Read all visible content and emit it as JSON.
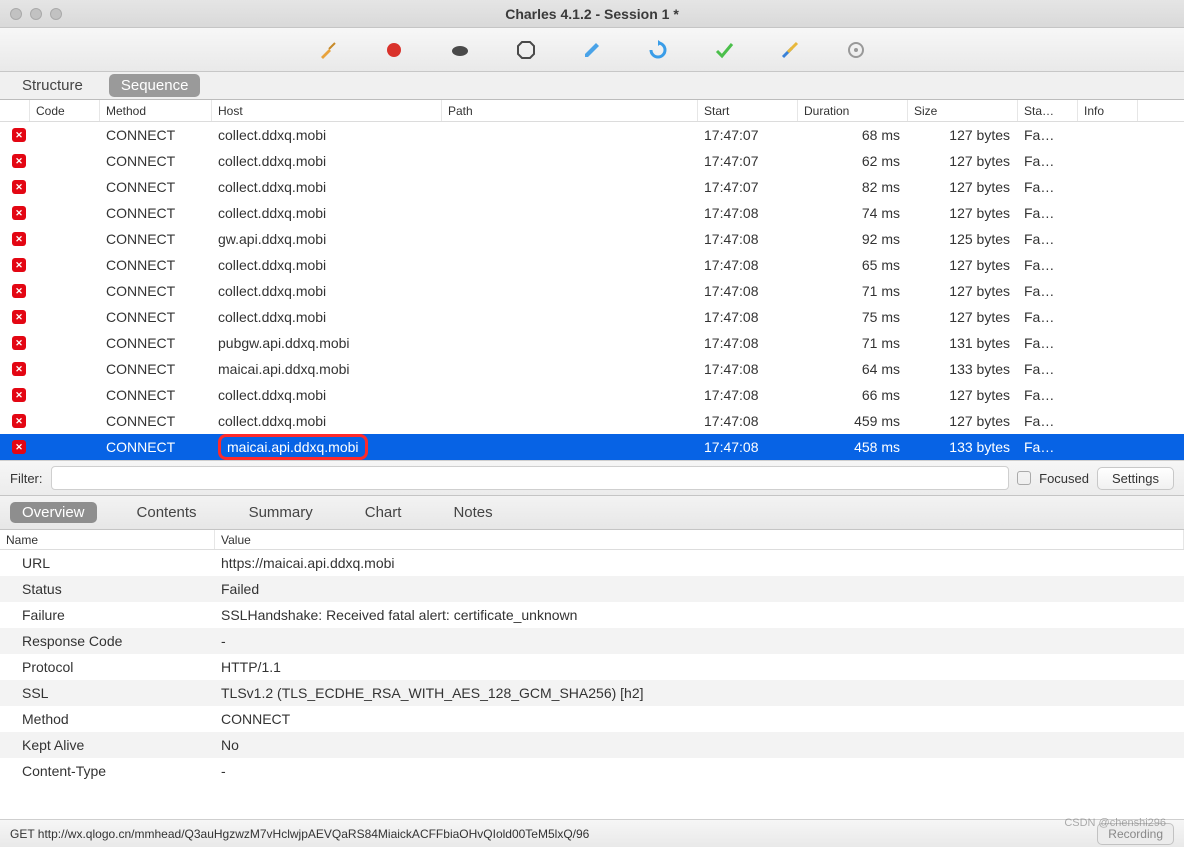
{
  "window": {
    "title": "Charles 4.1.2 - Session 1 *"
  },
  "tabs": {
    "structure": "Structure",
    "sequence": "Sequence",
    "active": "sequence"
  },
  "columns": {
    "code": "Code",
    "method": "Method",
    "host": "Host",
    "path": "Path",
    "start": "Start",
    "duration": "Duration",
    "size": "Size",
    "status": "Sta…",
    "info": "Info"
  },
  "rows": [
    {
      "method": "CONNECT",
      "host": "collect.ddxq.mobi",
      "path": "",
      "start": "17:47:07",
      "duration": "68 ms",
      "size": "127 bytes",
      "status": "Fa…",
      "selected": false
    },
    {
      "method": "CONNECT",
      "host": "collect.ddxq.mobi",
      "path": "",
      "start": "17:47:07",
      "duration": "62 ms",
      "size": "127 bytes",
      "status": "Fa…",
      "selected": false
    },
    {
      "method": "CONNECT",
      "host": "collect.ddxq.mobi",
      "path": "",
      "start": "17:47:07",
      "duration": "82 ms",
      "size": "127 bytes",
      "status": "Fa…",
      "selected": false
    },
    {
      "method": "CONNECT",
      "host": "collect.ddxq.mobi",
      "path": "",
      "start": "17:47:08",
      "duration": "74 ms",
      "size": "127 bytes",
      "status": "Fa…",
      "selected": false
    },
    {
      "method": "CONNECT",
      "host": "gw.api.ddxq.mobi",
      "path": "",
      "start": "17:47:08",
      "duration": "92 ms",
      "size": "125 bytes",
      "status": "Fa…",
      "selected": false
    },
    {
      "method": "CONNECT",
      "host": "collect.ddxq.mobi",
      "path": "",
      "start": "17:47:08",
      "duration": "65 ms",
      "size": "127 bytes",
      "status": "Fa…",
      "selected": false
    },
    {
      "method": "CONNECT",
      "host": "collect.ddxq.mobi",
      "path": "",
      "start": "17:47:08",
      "duration": "71 ms",
      "size": "127 bytes",
      "status": "Fa…",
      "selected": false
    },
    {
      "method": "CONNECT",
      "host": "collect.ddxq.mobi",
      "path": "",
      "start": "17:47:08",
      "duration": "75 ms",
      "size": "127 bytes",
      "status": "Fa…",
      "selected": false
    },
    {
      "method": "CONNECT",
      "host": "pubgw.api.ddxq.mobi",
      "path": "",
      "start": "17:47:08",
      "duration": "71 ms",
      "size": "131 bytes",
      "status": "Fa…",
      "selected": false
    },
    {
      "method": "CONNECT",
      "host": "maicai.api.ddxq.mobi",
      "path": "",
      "start": "17:47:08",
      "duration": "64 ms",
      "size": "133 bytes",
      "status": "Fa…",
      "selected": false
    },
    {
      "method": "CONNECT",
      "host": "collect.ddxq.mobi",
      "path": "",
      "start": "17:47:08",
      "duration": "66 ms",
      "size": "127 bytes",
      "status": "Fa…",
      "selected": false
    },
    {
      "method": "CONNECT",
      "host": "collect.ddxq.mobi",
      "path": "",
      "start": "17:47:08",
      "duration": "459 ms",
      "size": "127 bytes",
      "status": "Fa…",
      "selected": false
    },
    {
      "method": "CONNECT",
      "host": "maicai.api.ddxq.mobi",
      "path": "",
      "start": "17:47:08",
      "duration": "458 ms",
      "size": "133 bytes",
      "status": "Fa…",
      "selected": true,
      "highlight": true
    }
  ],
  "filter": {
    "label": "Filter:",
    "value": "",
    "focused": "Focused",
    "settings": "Settings"
  },
  "subtabs": {
    "overview": "Overview",
    "contents": "Contents",
    "summary": "Summary",
    "chart": "Chart",
    "notes": "Notes",
    "active": "overview"
  },
  "detailsHead": {
    "name": "Name",
    "value": "Value"
  },
  "details": [
    {
      "name": "URL",
      "value": "https://maicai.api.ddxq.mobi"
    },
    {
      "name": "Status",
      "value": "Failed"
    },
    {
      "name": "Failure",
      "value": "SSLHandshake: Received fatal alert: certificate_unknown"
    },
    {
      "name": "Response Code",
      "value": "-"
    },
    {
      "name": "Protocol",
      "value": "HTTP/1.1"
    },
    {
      "name": "SSL",
      "value": "TLSv1.2 (TLS_ECDHE_RSA_WITH_AES_128_GCM_SHA256) [h2]"
    },
    {
      "name": "Method",
      "value": "CONNECT"
    },
    {
      "name": "Kept Alive",
      "value": "No"
    },
    {
      "name": "Content-Type",
      "value": "-"
    }
  ],
  "status": {
    "left": "GET http://wx.qlogo.cn/mmhead/Q3auHgzwzM7vHclwjpAEVQaRS84MiaickACFFbiaOHvQIold00TeM5lxQ/96",
    "rec": "Recording"
  },
  "watermark": "CSDN @chenshi296"
}
